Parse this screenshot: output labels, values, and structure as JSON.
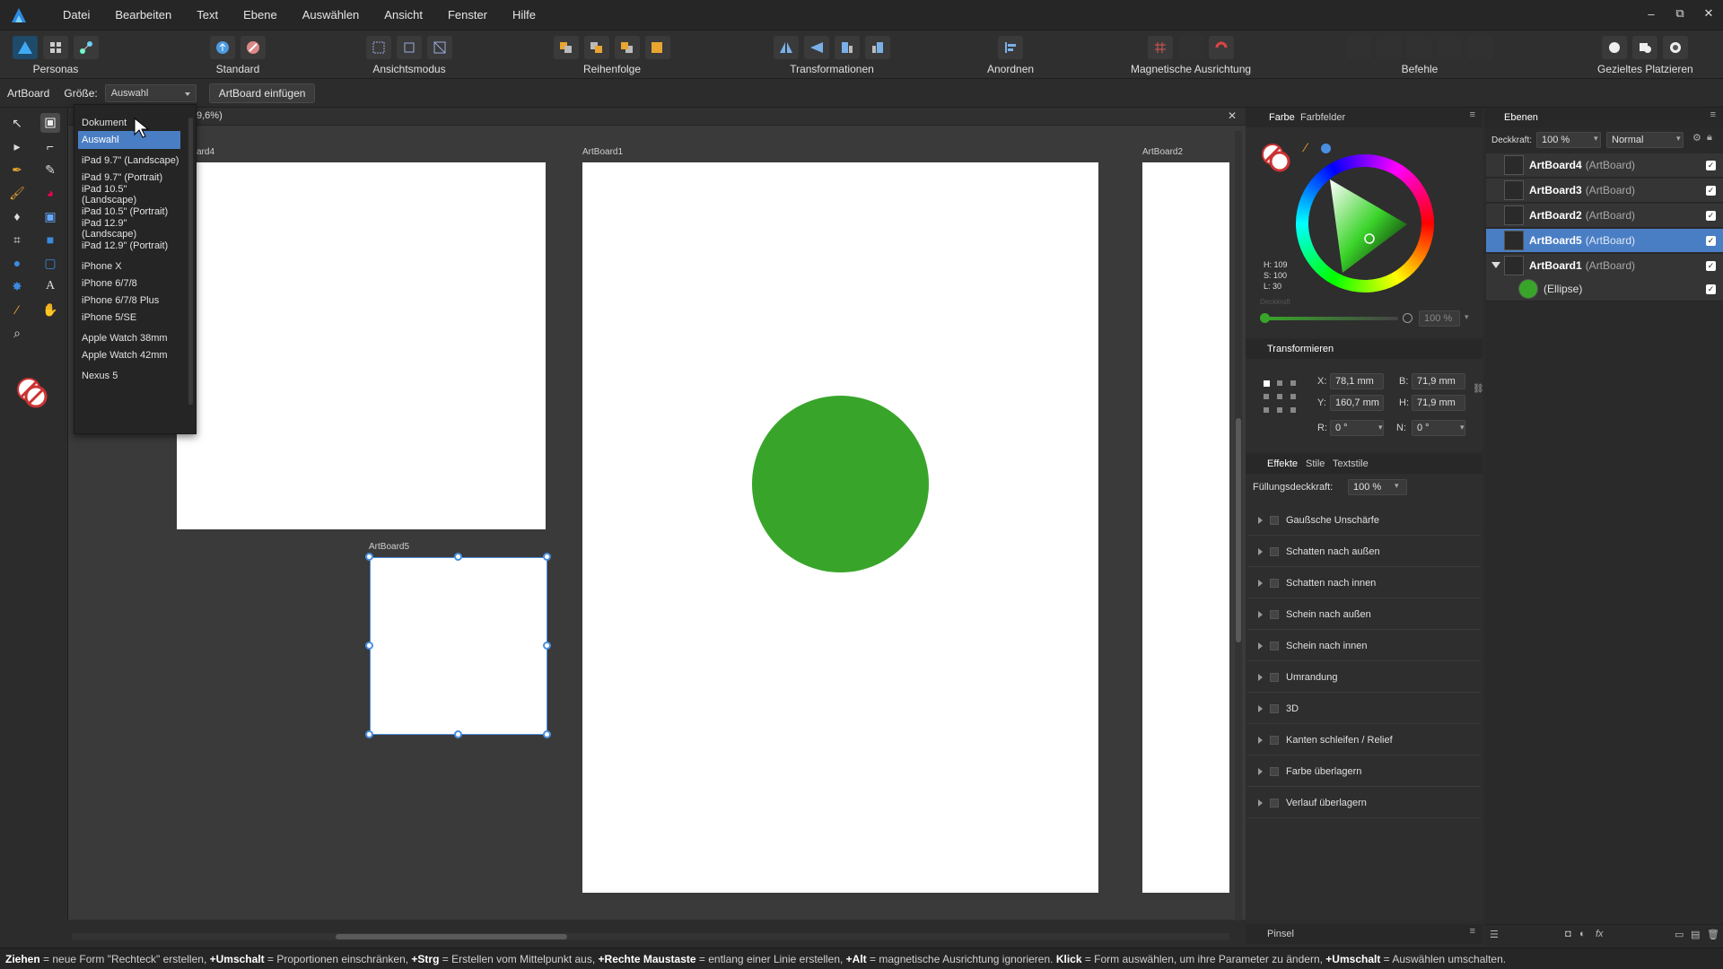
{
  "menubar": {
    "items": [
      "Datei",
      "Bearbeiten",
      "Text",
      "Ebene",
      "Auswählen",
      "Ansicht",
      "Fenster",
      "Hilfe"
    ],
    "window_controls": [
      "–",
      "⧉",
      "✕"
    ]
  },
  "toolbar": {
    "personas": "Personas",
    "standard": "Standard",
    "view_mode": "Ansichtsmodus",
    "order": "Reihenfolge",
    "transform": "Transformationen",
    "arrange": "Anordnen",
    "snapping": "Magnetische Ausrichtung",
    "commands": "Befehle",
    "placement": "Gezieltes Platzieren"
  },
  "context": {
    "artboard_label": "ArtBoard",
    "size_label": "Größe:",
    "size_value": "Auswahl",
    "insert_button": "ArtBoard einfügen"
  },
  "document": {
    "zoom_fragment": "9,6%)",
    "close": "✕"
  },
  "dropdown": {
    "items": [
      {
        "label": "Dokument"
      },
      {
        "label": "Auswahl",
        "selected": true
      },
      {
        "label": "iPad 9.7\" (Landscape)"
      },
      {
        "label": "iPad 9.7\" (Portrait)"
      },
      {
        "label": "iPad 10.5\" (Landscape)"
      },
      {
        "label": "iPad 10.5\" (Portrait)"
      },
      {
        "label": "iPad 12.9\" (Landscape)"
      },
      {
        "label": "iPad 12.9\" (Portrait)"
      },
      {
        "label": "iPhone X"
      },
      {
        "label": "iPhone 6/7/8"
      },
      {
        "label": "iPhone 6/7/8 Plus"
      },
      {
        "label": "iPhone 5/SE"
      },
      {
        "label": "Apple Watch 38mm"
      },
      {
        "label": "Apple Watch 42mm"
      },
      {
        "label": "Nexus 5"
      }
    ]
  },
  "artboards": {
    "ab4_label": "ard4",
    "ab1_label": "ArtBoard1",
    "ab2_label": "ArtBoard2",
    "ab5_label": "ArtBoard5",
    "ellipse_color": "#38a52a"
  },
  "color_panel": {
    "tab_color": "Farbe",
    "tab_swatches": "Farbfelder",
    "h": "H: 109",
    "s": "S: 100",
    "l": "L: 30",
    "opacity_label": "Deckkraft",
    "opacity_value": "100 %"
  },
  "transform_panel": {
    "title": "Transformieren",
    "x_label": "X:",
    "x_value": "78,1 mm",
    "y_label": "Y:",
    "y_value": "160,7 mm",
    "w_label": "B:",
    "w_value": "71,9 mm",
    "h_label": "H:",
    "h_value": "71,9 mm",
    "r_label": "R:",
    "r_value": "0 °",
    "s_label": "N:",
    "s_value": "0 °"
  },
  "effects_panel": {
    "tab_effects": "Effekte",
    "tab_styles": "Stile",
    "tab_textstyles": "Textstile",
    "fill_opacity_label": "Füllungsdeckkraft:",
    "fill_opacity_value": "100 %",
    "effects": [
      "Gaußsche Unschärfe",
      "Schatten nach außen",
      "Schatten nach innen",
      "Schein nach außen",
      "Schein nach innen",
      "Umrandung",
      "3D",
      "Kanten schleifen / Relief",
      "Farbe überlagern",
      "Verlauf überlagern"
    ],
    "bottom_tab": "Pinsel"
  },
  "layers_panel": {
    "title": "Ebenen",
    "opacity_label": "Deckkraft:",
    "opacity_value": "100 %",
    "blend_mode": "Normal",
    "layers": [
      {
        "name": "ArtBoard4",
        "type": "(ArtBoard)"
      },
      {
        "name": "ArtBoard3",
        "type": "(ArtBoard)"
      },
      {
        "name": "ArtBoard2",
        "type": "(ArtBoard)"
      },
      {
        "name": "ArtBoard5",
        "type": "(ArtBoard)",
        "selected": true
      },
      {
        "name": "ArtBoard1",
        "type": "(ArtBoard)"
      }
    ],
    "child": "(Ellipse)"
  },
  "status": {
    "parts": [
      {
        "b": "Ziehen",
        "t": " = neue Form \"Rechteck\" erstellen, "
      },
      {
        "b": "+Umschalt",
        "t": " = Proportionen einschränken, "
      },
      {
        "b": "+Strg",
        "t": " = Erstellen vom Mittelpunkt aus, "
      },
      {
        "b": "+Rechte Maustaste",
        "t": " = entlang einer Linie erstellen, "
      },
      {
        "b": "+Alt",
        "t": " = magnetische Ausrichtung ignorieren. "
      },
      {
        "b": "Klick",
        "t": " = Form auswählen, um ihre Parameter zu ändern, "
      },
      {
        "b": "+Umschalt",
        "t": " = Auswählen umschalten."
      }
    ]
  }
}
